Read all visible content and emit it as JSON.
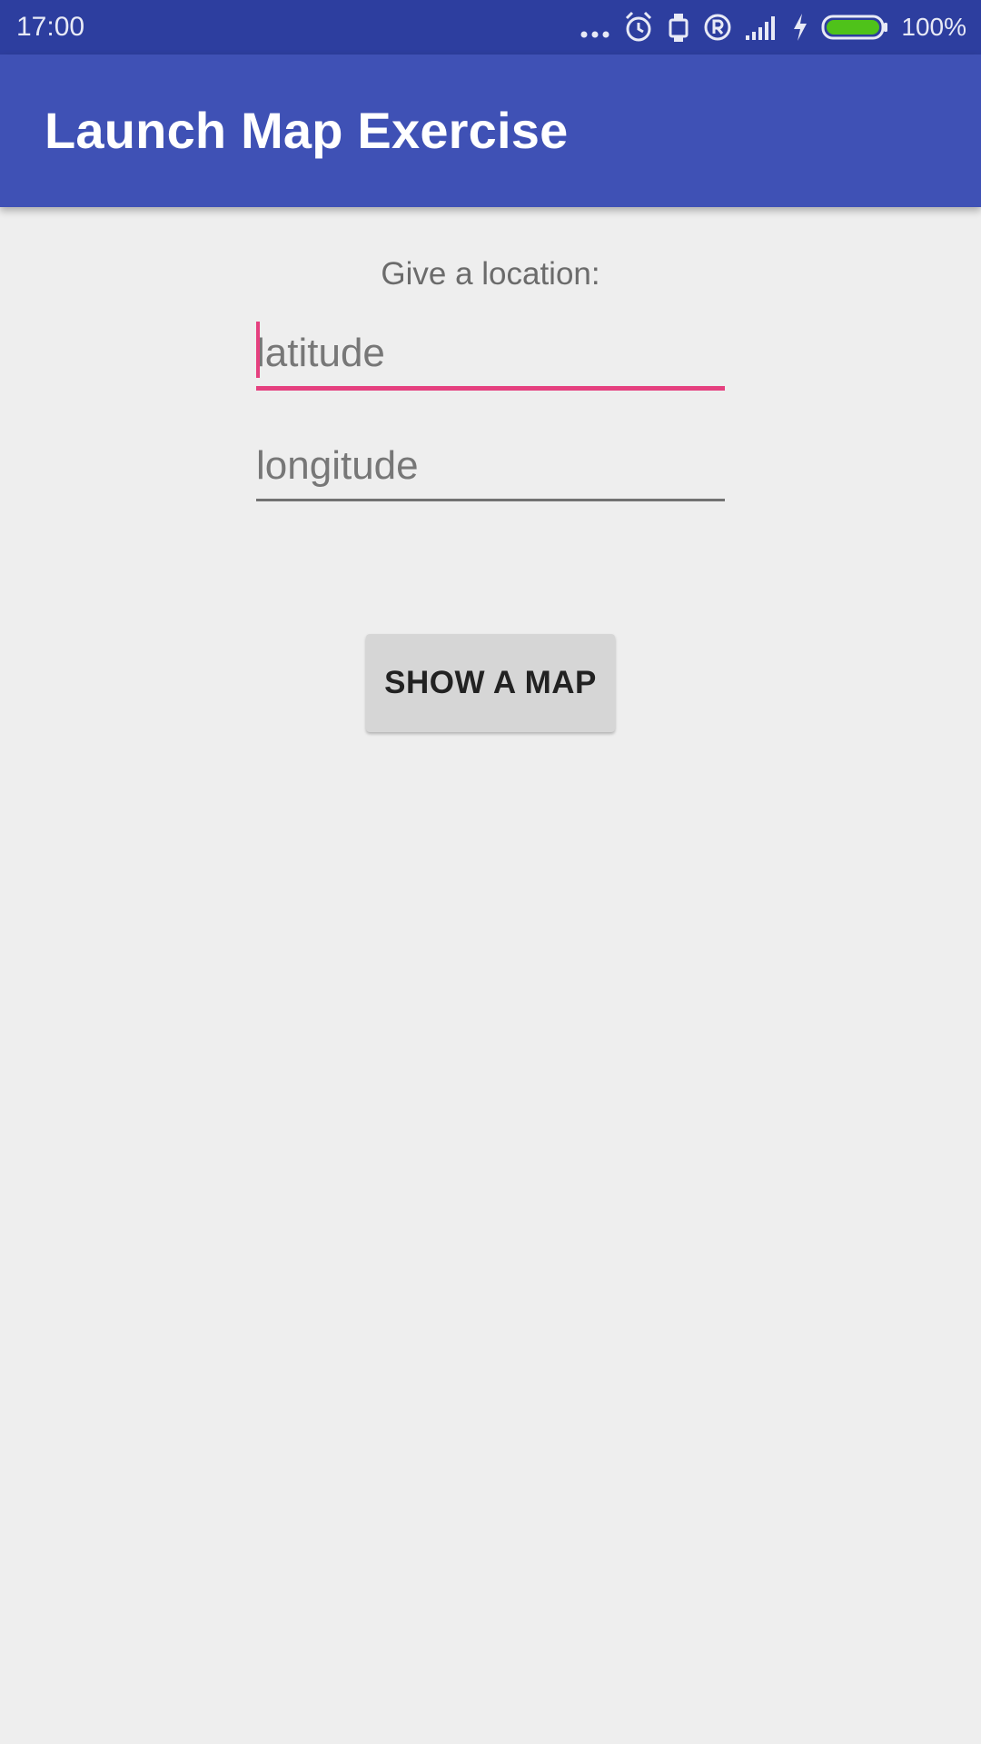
{
  "status_bar": {
    "time": "17:00",
    "battery_percent": "100%",
    "icons": [
      "more-dots-icon",
      "alarm-icon",
      "watch-icon",
      "registered-icon",
      "signal-icon",
      "charging-icon",
      "battery-icon"
    ],
    "battery_color": "#4fc21a"
  },
  "app_bar": {
    "title": "Launch Map Exercise",
    "color": "#3f51b5"
  },
  "form": {
    "prompt": "Give a location:",
    "latitude": {
      "placeholder": "latitude",
      "value": ""
    },
    "longitude": {
      "placeholder": "longitude",
      "value": ""
    },
    "accent_color": "#e5407f"
  },
  "actions": {
    "show_map_label": "SHOW A MAP"
  }
}
